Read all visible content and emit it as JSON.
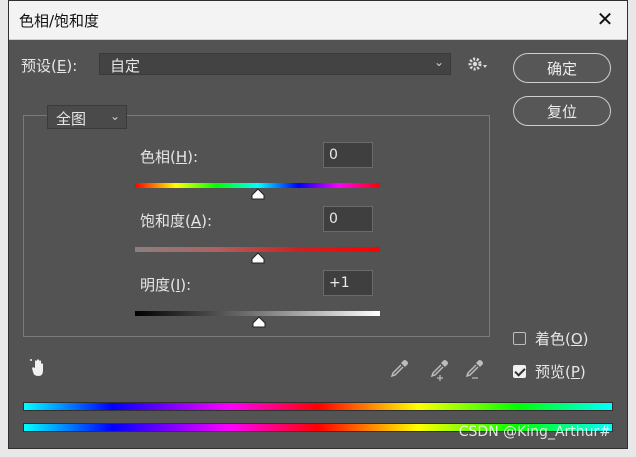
{
  "window": {
    "title": "色相/饱和度",
    "close_glyph": "✕"
  },
  "preset": {
    "label_prefix": "预设(",
    "label_key": "E",
    "label_suffix": "):",
    "value": "自定",
    "gear_icon": "gear-icon"
  },
  "buttons": {
    "ok": "确定",
    "reset": "复位"
  },
  "scope": {
    "value": "全图"
  },
  "hue": {
    "label_prefix": "色相(",
    "label_key": "H",
    "label_suffix": "):",
    "value": "0",
    "level": 0.5
  },
  "saturation": {
    "label_prefix": "饱和度(",
    "label_key": "A",
    "label_suffix": "):",
    "value": "0",
    "level": 0.5
  },
  "lightness": {
    "label_prefix": "明度(",
    "label_key": "I",
    "label_suffix": "):",
    "value": "+1",
    "level": 0.505
  },
  "colorize": {
    "label_prefix": "着色(",
    "label_key": "O",
    "label_suffix": ")",
    "checked": false
  },
  "preview": {
    "label_prefix": "预览(",
    "label_key": "P",
    "label_suffix": ")",
    "checked": true
  },
  "tools": {
    "hand": "hand-adjust-icon",
    "eyedropper": "eyedropper-icon",
    "eyedropper_add": "eyedropper-plus-icon",
    "eyedropper_sub": "eyedropper-minus-icon"
  },
  "watermark": "CSDN @King_Arthur#"
}
